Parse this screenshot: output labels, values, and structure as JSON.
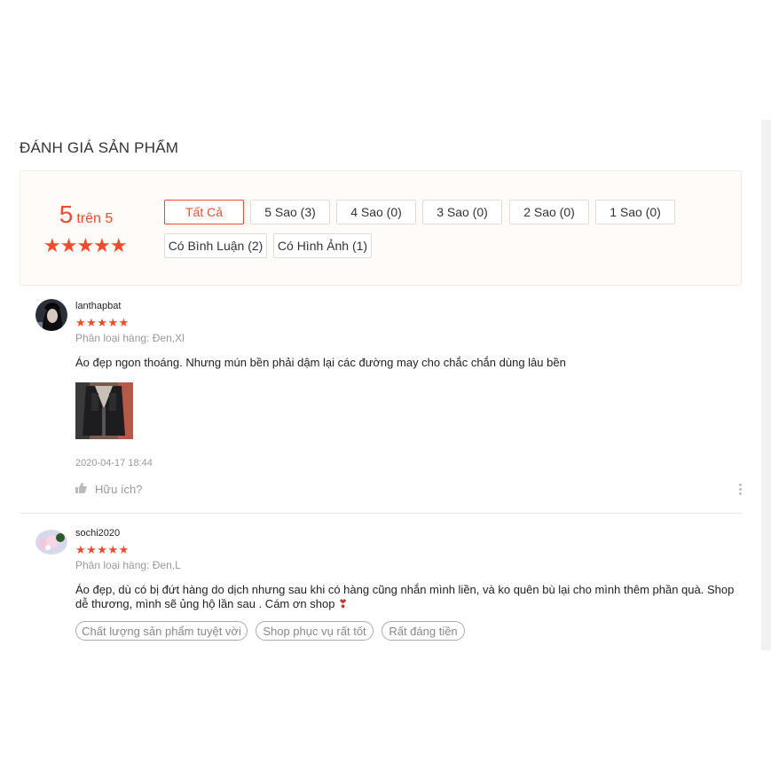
{
  "section_title": "ĐÁNH GIÁ SẢN PHẨM",
  "overview": {
    "score": "5",
    "score_suffix": "trên 5",
    "rating": 5,
    "filters": [
      {
        "label": "Tất Cả",
        "active": true
      },
      {
        "label": "5 Sao (3)"
      },
      {
        "label": "4 Sao (0)"
      },
      {
        "label": "3 Sao (0)"
      },
      {
        "label": "2 Sao (0)"
      },
      {
        "label": "1 Sao (0)"
      },
      {
        "label": "Có Bình Luận (2)"
      },
      {
        "label": "Có Hình Ảnh (1)"
      }
    ]
  },
  "reviews": [
    {
      "username": "lanthapbat",
      "stars": "★★★★★",
      "rating": 5,
      "variant": "Phân loại hàng: Đen,Xl",
      "comment": "Áo đẹp ngon thoáng. Nhưng mún bền phải dậm lại các đường may cho chắc chắn dùng lâu bền",
      "time": "2020-04-17 18:44",
      "helpful_label": "Hữu ích?"
    },
    {
      "username": "sochi2020",
      "stars": "★★★★★",
      "rating": 5,
      "variant": "Phân loại hàng: Đen,L",
      "comment": "Áo đẹp, dù có bị đứt hàng do dịch nhưng sau khi có hàng cũng nhắn mình liền, và ko quên bù lại cho mình thêm phần quà. Shop dễ thương, mình sẽ ủng hộ lần sau . Cám ơn shop",
      "comment_emoji": "❣",
      "tags": [
        "Chất lượng sản phẩm tuyệt vời",
        "Shop phục vụ rất tốt",
        "Rất đáng tiền"
      ]
    }
  ],
  "colors": {
    "accent": "#ee4d2d",
    "muted": "#999999"
  }
}
